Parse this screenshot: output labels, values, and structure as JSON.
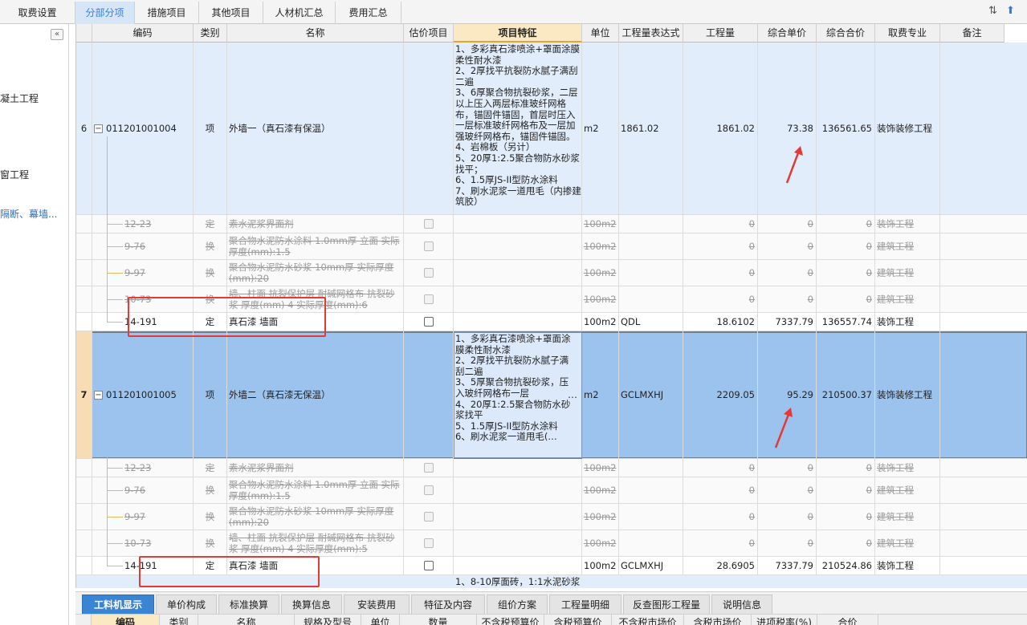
{
  "top_tabs": [
    "取费设置",
    "分部分项",
    "措施项目",
    "其他项目",
    "人材机汇总",
    "费用汇总"
  ],
  "top_icons": [
    "sort-icon",
    "arrow-up-icon"
  ],
  "sidebar": {
    "collapse_label": "«",
    "items": [
      "凝土工程",
      "窗工程",
      "隔断、幕墙..."
    ]
  },
  "columns": [
    "编码",
    "类别",
    "名称",
    "估价项目",
    "项目特征",
    "单位",
    "工程量表达式",
    "工程量",
    "综合单价",
    "综合合价",
    "取费专业",
    "备注"
  ],
  "rows": [
    {
      "seq": "6",
      "code": "011201001004",
      "kind": "项",
      "name": "外墙一（真石漆有保温）",
      "feature": "1、多彩真石漆喷涂+罩面涂膜柔性耐水漆\n2、2厚找平抗裂防水腻子满刮二遍\n3、6厚聚合物抗裂砂浆，二层以上压入两层标准玻纤网格布，锚固件锚固，首层时压入一层标准玻纤网格布及一层加强玻纤网格布，锚固件锚固。\n4、岩棉板（另计）\n5、20厚1:2.5聚合物防水砂浆找平；\n6、1.5厚JS-II型防水涂料\n7、刷水泥浆一道甩毛（内掺建筑胶）",
      "unit": "m2",
      "expr": "1861.02",
      "qty": "1861.02",
      "price": "73.38",
      "total": "136561.65",
      "prof": "装饰装修工程",
      "subs": [
        {
          "code": "12-23",
          "kind": "定",
          "name": "素水泥浆界面剂",
          "unit": "100m2",
          "qty": "0",
          "price": "0",
          "total": "0",
          "prof": "装饰工程",
          "struck": true
        },
        {
          "code": "9-76",
          "kind": "换",
          "name": "聚合物水泥防水涂料 1.0mm厚 立面 实际厚度(mm):1.5",
          "unit": "100m2",
          "qty": "0",
          "price": "0",
          "total": "0",
          "prof": "建筑工程",
          "struck": true
        },
        {
          "code": "9-97",
          "kind": "换",
          "name": "聚合物水泥防水砂浆 10mm厚 实际厚度(mm):20",
          "unit": "100m2",
          "qty": "0",
          "price": "0",
          "total": "0",
          "prof": "建筑工程",
          "struck": true
        },
        {
          "code": "10-73",
          "kind": "换",
          "name": "墙、柱面 抗裂保护层 耐碱网格布 抗裂砂浆 厚度(mm) 4 实际厚度(mm):6",
          "unit": "100m2",
          "qty": "0",
          "price": "0",
          "total": "0",
          "prof": "建筑工程",
          "struck": true
        },
        {
          "code": "14-191",
          "kind": "定",
          "name": "真石漆 墙面",
          "unit": "100m2",
          "expr": "QDL",
          "qty": "18.6102",
          "price": "7337.79",
          "total": "136557.74",
          "prof": "装饰工程",
          "struck": false
        }
      ]
    },
    {
      "seq": "7",
      "code": "011201001005",
      "kind": "项",
      "name": "外墙二（真石漆无保温）",
      "feature": "1、多彩真石漆喷涂+罩面涂膜柔性耐水漆\n2、2厚找平抗裂防水腻子满刮二遍\n3、5厚聚合物抗裂砂浆，压入玻纤网格布一层\n4、20厚1:2.5聚合物防水砂浆找平\n5、1.5厚JS-II型防水涂料\n6、刷水泥浆一道甩毛(…",
      "feature_more": "…",
      "unit": "m2",
      "expr": "GCLMXHJ",
      "qty": "2209.05",
      "price": "95.29",
      "total": "210500.37",
      "prof": "装饰装修工程",
      "subs": [
        {
          "code": "12-23",
          "kind": "定",
          "name": "素水泥浆界面剂",
          "unit": "100m2",
          "qty": "0",
          "price": "0",
          "total": "0",
          "prof": "装饰工程",
          "struck": true
        },
        {
          "code": "9-76",
          "kind": "换",
          "name": "聚合物水泥防水涂料 1.0mm厚 立面 实际厚度(mm):1.5",
          "unit": "100m2",
          "qty": "0",
          "price": "0",
          "total": "0",
          "prof": "建筑工程",
          "struck": true
        },
        {
          "code": "9-97",
          "kind": "换",
          "name": "聚合物水泥防水砂浆 10mm厚 实际厚度(mm):20",
          "unit": "100m2",
          "qty": "0",
          "price": "0",
          "total": "0",
          "prof": "建筑工程",
          "struck": true
        },
        {
          "code": "10-73",
          "kind": "换",
          "name": "墙、柱面 抗裂保护层 耐碱网格布 抗裂砂浆 厚度(mm) 4 实际厚度(mm):5",
          "unit": "100m2",
          "qty": "0",
          "price": "0",
          "total": "0",
          "prof": "建筑工程",
          "struck": true
        },
        {
          "code": "14-191",
          "kind": "定",
          "name": "真石漆 墙面",
          "unit": "100m2",
          "expr": "GCLMXHJ",
          "qty": "28.6905",
          "price": "7337.79",
          "total": "210524.86",
          "prof": "装饰工程",
          "struck": false
        }
      ]
    }
  ],
  "next_row_feature": "1、8-10厚面砖，1:1水泥砂浆",
  "bottom_tabs": [
    "工料机显示",
    "单价构成",
    "标准换算",
    "换算信息",
    "安装费用",
    "特征及内容",
    "组价方案",
    "工程量明细",
    "反查图形工程量",
    "说明信息"
  ],
  "bottom_columns": [
    "编码",
    "类别",
    "名称",
    "规格及型号",
    "单位",
    "数量",
    "不含税预算价",
    "含税预算价",
    "不含税市场价",
    "含税市场价",
    "进项税率(%)",
    "合价"
  ],
  "colors": {
    "accent": "#3a84d4",
    "selected_row": "#9cc3ee",
    "item_row": "#e2edfb",
    "feature_header": "#fbe9c4",
    "annotation_red": "#e53935"
  }
}
